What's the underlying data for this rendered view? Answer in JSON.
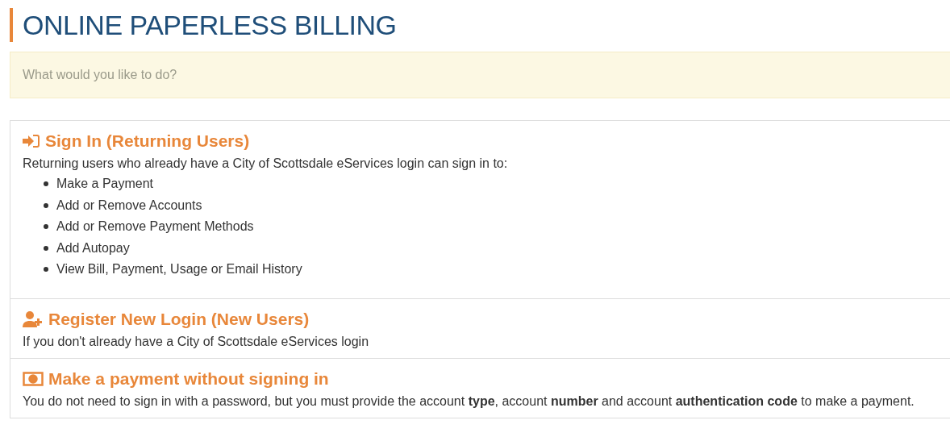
{
  "page_title": "ONLINE PAPERLESS BILLING",
  "prompt": "What would you like to do?",
  "options": [
    {
      "kind": "sign-in",
      "title": "Sign In (Returning Users)",
      "description": "Returning users who already have a City of Scottsdale eServices login can sign in to:",
      "items": [
        "Make a Payment",
        "Add or Remove Accounts",
        "Add or Remove Payment Methods",
        "Add Autopay",
        "View Bill, Payment, Usage or Email History"
      ]
    },
    {
      "kind": "register",
      "title": "Register New Login (New Users)",
      "description": "If you don't already have a City of Scottsdale eServices login"
    },
    {
      "kind": "payment",
      "title": "Make a payment without signing in",
      "description": "You do not need to sign in with a password, but you must provide the account **type**, account **number** and account **authentication code** to make a payment."
    }
  ]
}
